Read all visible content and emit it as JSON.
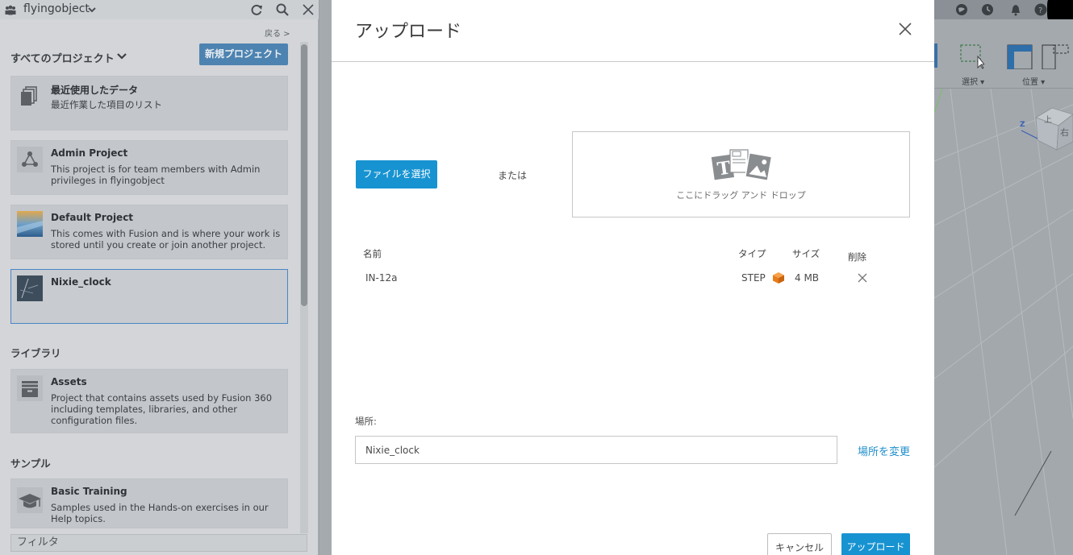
{
  "left_panel": {
    "hub_name": "flyingobject",
    "back_link": "戻る >",
    "projects_header": "すべてのプロジェクト",
    "new_project_button": "新規プロジェクト",
    "cards": [
      {
        "title": "最近使用したデータ",
        "desc": "最近作業した項目のリスト",
        "icon": "files-icon"
      },
      {
        "title": "Admin Project",
        "desc": "This project is for team members with Admin privileges in flyingobject",
        "icon": "share-nodes-icon"
      },
      {
        "title": "Default Project",
        "desc": "This comes with Fusion and is where your work is stored until you create or join another project.",
        "icon": "project-thumbnail"
      },
      {
        "title": "Nixie_clock",
        "desc": "",
        "icon": "project-thumbnail"
      }
    ],
    "library_label": "ライブラリ",
    "library_cards": [
      {
        "title": "Assets",
        "desc": "Project that contains assets used by Fusion 360 including templates, libraries, and other configuration files.",
        "icon": "archive-icon"
      }
    ],
    "samples_label": "サンプル",
    "sample_cards": [
      {
        "title": "Basic Training",
        "desc": "Samples used in the Hands-on exercises in our Help topics.",
        "icon": "graduation-cap-icon"
      }
    ],
    "filter_placeholder": "フィルタ"
  },
  "toolbar_right": {
    "select_label": "選択 ▾",
    "position_label": "位置 ▾"
  },
  "viewcube": {
    "face_top": "上",
    "face_right": "右",
    "axis_z": "Z"
  },
  "modal": {
    "title": "アップロード",
    "choose_file_button": "ファイルを選択",
    "or_label": "または",
    "dropzone_text": "ここにドラッグ アンド ドロップ",
    "table_headers": {
      "name": "名前",
      "type": "タイプ",
      "size": "サイズ",
      "delete": "削除"
    },
    "files": [
      {
        "name": "IN-12a",
        "type": "STEP",
        "size": "4 MB"
      }
    ],
    "location_label": "場所:",
    "location_value": "Nixie_clock",
    "change_location_link": "場所を変更",
    "cancel_button": "キャンセル",
    "upload_button": "アップロード"
  },
  "colors": {
    "accent": "#1793d1",
    "panel_button": "#4d83b0",
    "step_icon": "#f08a24"
  }
}
